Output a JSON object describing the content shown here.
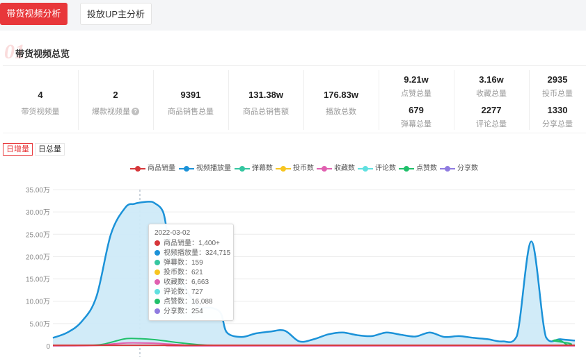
{
  "tabs": [
    {
      "label": "带货视频分析",
      "active": true
    },
    {
      "label": "投放UP主分析",
      "active": false
    }
  ],
  "section": {
    "title": "带货视频总览"
  },
  "stats": [
    {
      "value": "4",
      "label": "带货视频量"
    },
    {
      "value": "2",
      "label": "爆款视频量",
      "help_icon": "question-circle-icon"
    },
    {
      "value": "9391",
      "label": "商品销售总量"
    },
    {
      "value": "131.38w",
      "label": "商品总销售额"
    },
    {
      "value": "176.83w",
      "label": "播放总数"
    }
  ],
  "double_stats": [
    {
      "value": "9.21w",
      "label": "点赞总量"
    },
    {
      "value": "679",
      "label": "弹幕总量"
    },
    {
      "value": "3.16w",
      "label": "收藏总量"
    },
    {
      "value": "2277",
      "label": "评论总量"
    },
    {
      "value": "2935",
      "label": "投币总量"
    },
    {
      "value": "1330",
      "label": "分享总量"
    }
  ],
  "toggles": [
    {
      "label": "日增量",
      "active": true
    },
    {
      "label": "日总量",
      "active": false
    }
  ],
  "colors": {
    "accent": "#e8373a"
  },
  "chart_data": {
    "type": "area",
    "legend": [
      {
        "name": "商品销量",
        "color": "#d6373a"
      },
      {
        "name": "视频播放量",
        "color": "#1b92d8"
      },
      {
        "name": "弹幕数",
        "color": "#34c6a0"
      },
      {
        "name": "投币数",
        "color": "#f7c520"
      },
      {
        "name": "收藏数",
        "color": "#e060b0"
      },
      {
        "name": "评论数",
        "color": "#5fe0e0"
      },
      {
        "name": "点赞数",
        "color": "#1fc06a"
      },
      {
        "name": "分享数",
        "color": "#8f7be0"
      }
    ],
    "yticks": [
      "35.00万",
      "30.00万",
      "25.00万",
      "20.00万",
      "15.00万",
      "10.00万",
      "5.00万",
      "0"
    ],
    "ylim": [
      0,
      350000
    ],
    "xlim": [
      0,
      36
    ],
    "highlight_x": 6,
    "series": [
      {
        "name": "视频播放量",
        "color": "#1b92d8",
        "fill": true,
        "x": [
          0,
          1,
          2,
          3,
          4,
          5,
          5.6,
          6,
          6.6,
          7,
          7.6,
          8,
          9,
          10,
          11,
          11.6,
          12,
          13,
          14,
          15,
          16,
          17,
          18,
          19,
          20,
          21,
          22,
          23,
          24,
          25,
          26,
          27,
          28,
          29,
          30,
          31,
          32,
          33,
          34,
          35,
          36
        ],
        "y": [
          18000,
          30000,
          55000,
          110000,
          250000,
          310000,
          318000,
          321000,
          323000,
          320000,
          300000,
          240000,
          140000,
          90000,
          85000,
          72000,
          30000,
          20000,
          28000,
          32000,
          34000,
          10000,
          15000,
          26000,
          30000,
          24000,
          22000,
          30000,
          25000,
          21000,
          30000,
          20000,
          22000,
          18000,
          15000,
          10000,
          22000,
          234000,
          20000,
          15000,
          12000
        ]
      },
      {
        "name": "点赞数",
        "color": "#1fc06a",
        "fill": false,
        "x": [
          0,
          3,
          4,
          5,
          6,
          7,
          8,
          9,
          10,
          11,
          12,
          34,
          34.5,
          35,
          35.5,
          36
        ],
        "y": [
          0,
          2000,
          8000,
          16000,
          16088,
          14000,
          10000,
          6000,
          3000,
          1000,
          0,
          0,
          12000,
          12000,
          2000,
          0
        ]
      },
      {
        "name": "收藏数",
        "color": "#e060b0",
        "fill": false,
        "x": [
          0,
          3,
          4,
          5,
          6,
          7,
          8,
          9,
          10,
          36
        ],
        "y": [
          0,
          1000,
          4000,
          6500,
          6663,
          6000,
          4000,
          2000,
          0,
          0
        ]
      },
      {
        "name": "商品销量",
        "color": "#d6373a",
        "fill": false,
        "x": [
          0,
          36
        ],
        "y": [
          1400,
          1400
        ]
      }
    ]
  },
  "tooltip": {
    "date": "2022-03-02",
    "rows": [
      {
        "name": "商品销量",
        "value": "1,400+",
        "color": "#d6373a"
      },
      {
        "name": "视频播放量",
        "value": "324,715",
        "color": "#1b92d8"
      },
      {
        "name": "弹幕数",
        "value": "159",
        "color": "#34c6a0"
      },
      {
        "name": "投币数",
        "value": "621",
        "color": "#f7c520"
      },
      {
        "name": "收藏数",
        "value": "6,663",
        "color": "#e060b0"
      },
      {
        "name": "评论数",
        "value": "727",
        "color": "#5fe0e0"
      },
      {
        "name": "点赞数",
        "value": "16,088",
        "color": "#1fc06a"
      },
      {
        "name": "分享数",
        "value": "254",
        "color": "#8f7be0"
      }
    ]
  }
}
